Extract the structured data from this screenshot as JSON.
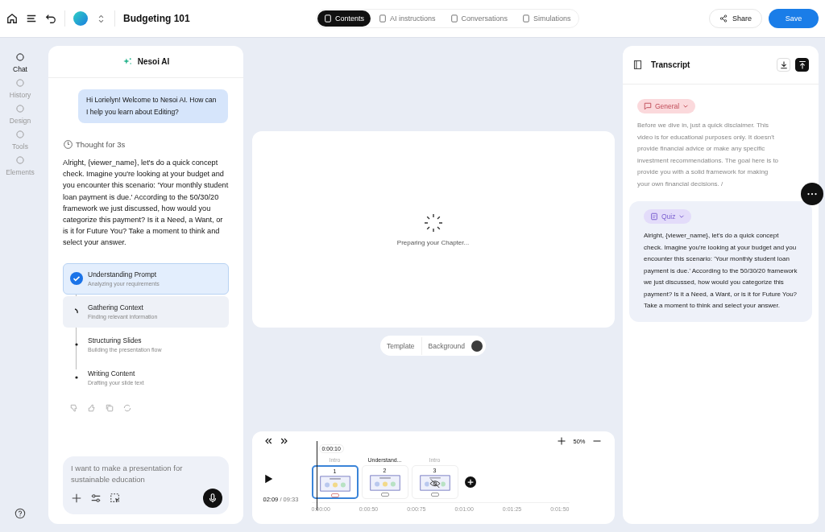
{
  "header": {
    "title": "Budgeting 101",
    "tabs": [
      {
        "label": "Contents",
        "selected": true
      },
      {
        "label": "AI instructions",
        "selected": false
      },
      {
        "label": "Conversations",
        "selected": false
      },
      {
        "label": "Simulations",
        "selected": false
      }
    ],
    "share": "Share",
    "save": "Save"
  },
  "rail": [
    {
      "label": "Chat",
      "selected": true
    },
    {
      "label": "History",
      "selected": false
    },
    {
      "label": "Design",
      "selected": false
    },
    {
      "label": "Tools",
      "selected": false
    },
    {
      "label": "Elements",
      "selected": false
    }
  ],
  "chat": {
    "title": "Nesoi AI",
    "greeting": "Hi Lorielyn! Welcome to Nesoi AI. How can I help you learn about Editing?",
    "thought": "Thought for 3s",
    "answer": "Alright, {viewer_name}, let's do a quick concept check. Imagine you're looking at your budget and you encounter this scenario: 'Your monthly student loan payment is due.' According to the 50/30/20 framework we just discussed, how would you categorize this payment? Is it a Need, a Want, or is it for Future You? Take a moment to think and select your answer.",
    "steps": [
      {
        "title": "Understanding Prompt",
        "detail": "Analyzing your requirements",
        "done": true,
        "active": false
      },
      {
        "title": "Gathering Context",
        "detail": "Finding relevant information",
        "done": false,
        "active": true
      },
      {
        "title": "Structuring Slides",
        "detail": "Building the presentation flow",
        "done": false,
        "active": false
      },
      {
        "title": "Writing Content",
        "detail": "Drafting your slide text",
        "done": false,
        "active": false
      }
    ],
    "input": {
      "placeholder": "I want to make a presentation for sustainable education"
    }
  },
  "stage": {
    "loading": "Preparing your Chapter...",
    "template": "Template",
    "background": "Background"
  },
  "timeline": {
    "playhead": "0:00:10",
    "current": "02:09",
    "total": "/ 09:33",
    "zoom": "50%",
    "clips": [
      {
        "label": "Intro",
        "number": "1",
        "selected": true,
        "hidden": false
      },
      {
        "label": "Understand...",
        "number": "2",
        "selected": false,
        "hidden": false
      },
      {
        "label": "Intro",
        "number": "3",
        "selected": false,
        "hidden": true
      }
    ],
    "ticks": [
      "0:00:00",
      "0:00:50",
      "0:00:75",
      "0:01:00",
      "0:01:25",
      "0:01:50"
    ]
  },
  "transcript": {
    "title": "Transcript",
    "blocks": [
      {
        "kind": "general",
        "tag": "General",
        "text": "Before we dive in, just a quick disclaimer. This video is for educational purposes only. It doesn't provide financial advice or make any specific investment recommendations. The goal here is to provide you with a solid framework for making your own financial decisions. /",
        "selected": false
      },
      {
        "kind": "quiz",
        "tag": "Quiz",
        "text": "Alright, {viewer_name}, let's do a quick concept check. Imagine you're looking at your budget and you encounter this scenario: 'Your monthly student loan payment is due.' According to the 50/30/20 framework we just discussed, how would you categorize this payment? Is it a Need, a Want, or is it for Future You? Take a moment to think and select your answer.",
        "selected": true
      }
    ]
  }
}
